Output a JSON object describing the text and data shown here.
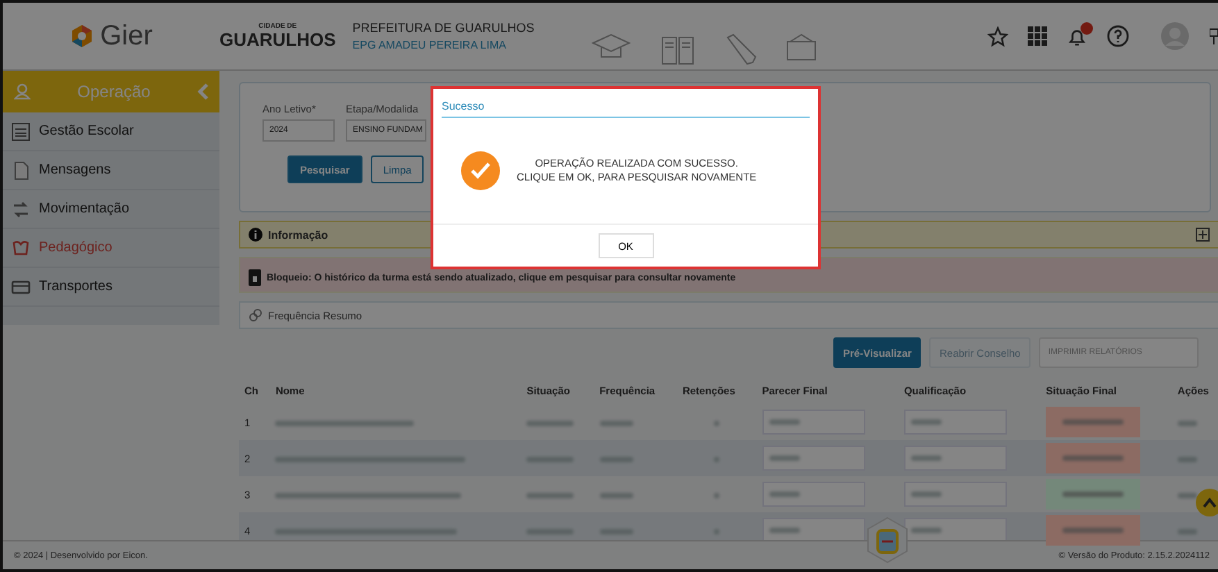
{
  "header": {
    "app_name": "Gier",
    "city_small": "CIDADE DE",
    "city": "GUARULHOS",
    "org": "PREFEITURA DE GUARULHOS",
    "school": "EPG AMADEU PEREIRA LIMA"
  },
  "sidebar": {
    "title": "Operação",
    "items": [
      {
        "label": "Gestão Escolar",
        "selected": false
      },
      {
        "label": "Mensagens",
        "selected": false
      },
      {
        "label": "Movimentação",
        "selected": false
      },
      {
        "label": "Pedagógico",
        "selected": true
      },
      {
        "label": "Transportes",
        "selected": false
      }
    ]
  },
  "filters": {
    "fields": [
      {
        "label": "Ano Letivo*",
        "value": "2024"
      },
      {
        "label": "Etapa/Modalida",
        "value": "ENSINO FUNDAM"
      }
    ],
    "buttons": [
      {
        "label": "Pesquisar",
        "kind": "primary"
      },
      {
        "label": "Limpa",
        "kind": "secondary"
      }
    ]
  },
  "info_panel": {
    "title": "Informação"
  },
  "alert": "Bloqueio: O histórico da turma está sendo atualizado, clique em pesquisar para consultar novamente",
  "summary_panel": {
    "title": "Frequência Resumo"
  },
  "actions": [
    {
      "label": "Pré-Visualizar",
      "kind": "button",
      "disabled": false
    },
    {
      "label": "Reabrir Conselho",
      "kind": "button",
      "disabled": true
    },
    {
      "label": "IMPRIMIR RELATÓRIOS",
      "kind": "select",
      "disabled": false
    }
  ],
  "table": {
    "columns": [
      "Ch",
      "Nome",
      "Situação",
      "Frequência",
      "Retenções",
      "Parecer Final",
      "Qualificação",
      "Situação Final",
      "Ações"
    ],
    "rows": [
      {
        "ch": "1",
        "color": "#8c6b63"
      },
      {
        "ch": "2",
        "color": "#8c6b63"
      },
      {
        "ch": "3",
        "color": "#74887a"
      },
      {
        "ch": "4",
        "color": "#8c6b63"
      }
    ]
  },
  "footer": {
    "left": "© 2024 | Desenvolvido por Eicon.",
    "right": "© Versão do Produto: 2.15.2.2024112"
  },
  "dialog": {
    "title": "Sucesso",
    "lines": [
      "OPERAÇÃO REALIZADA COM SUCESSO.",
      "CLIQUE EM OK, PARA PESQUISAR NOVAMENTE"
    ],
    "button": "OK"
  }
}
